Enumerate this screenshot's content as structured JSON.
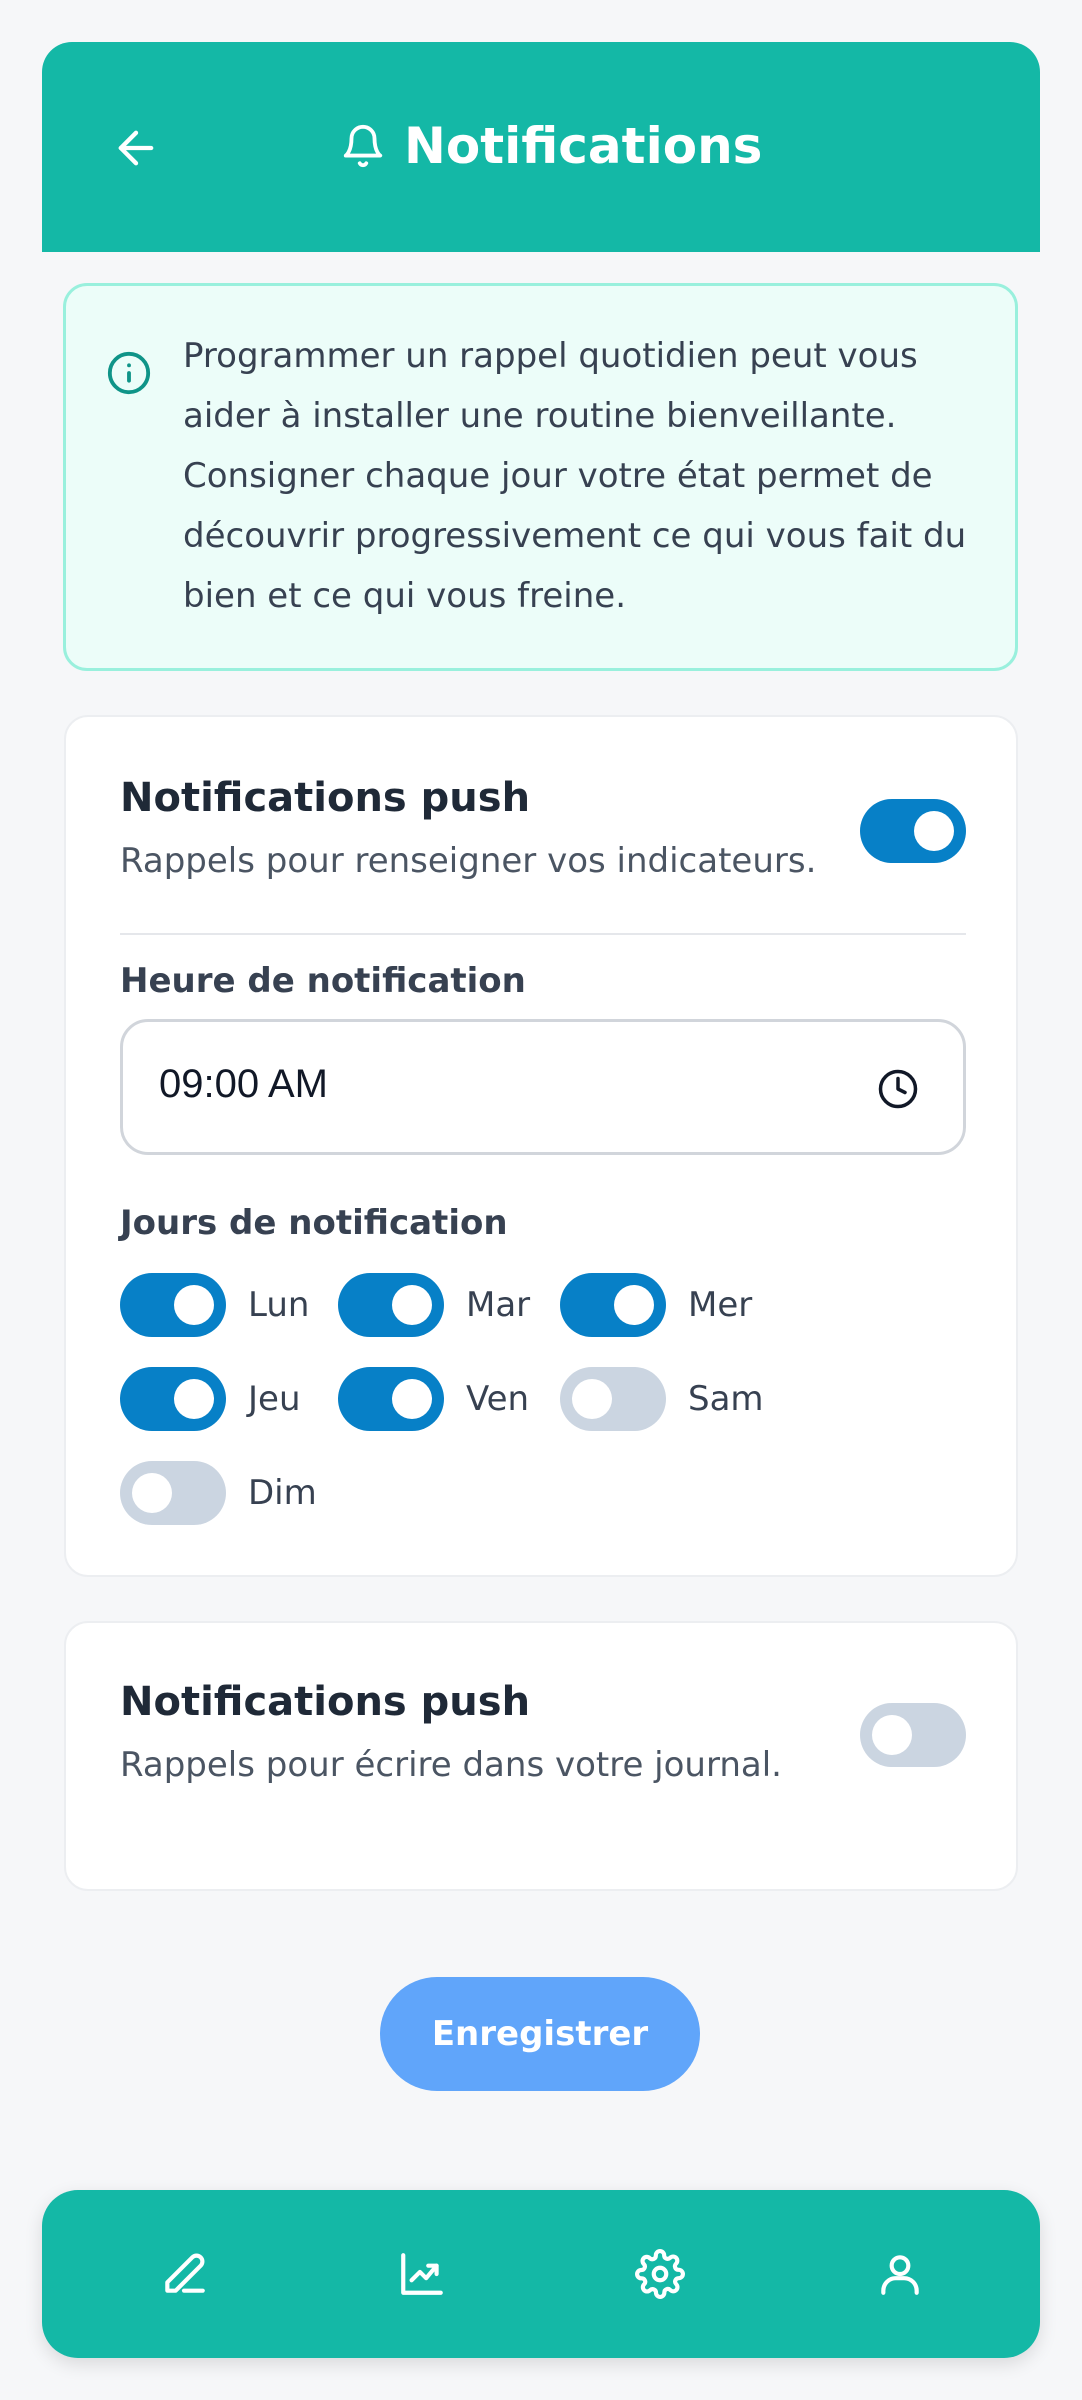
{
  "header": {
    "title": "Notifications",
    "back_icon": "arrow-left-icon",
    "title_icon": "bell-icon"
  },
  "info": {
    "icon": "info-icon",
    "text": "Programmer un rappel quotidien peut vous aider à installer une routine bienveillante. Consigner chaque jour votre état permet de découvrir progressivement ce qui vous fait du bien et ce qui vous freine."
  },
  "indicators_card": {
    "title": "Notifications push",
    "subtitle": "Rappels pour renseigner vos indicateurs.",
    "enabled": true,
    "time_label": "Heure de notification",
    "time_value": "09:00 AM",
    "days_label": "Jours de notification",
    "days": [
      {
        "label": "Lun",
        "on": true
      },
      {
        "label": "Mar",
        "on": true
      },
      {
        "label": "Mer",
        "on": true
      },
      {
        "label": "Jeu",
        "on": true
      },
      {
        "label": "Ven",
        "on": true
      },
      {
        "label": "Sam",
        "on": false
      },
      {
        "label": "Dim",
        "on": false
      }
    ]
  },
  "journal_card": {
    "title": "Notifications push",
    "subtitle": "Rappels pour écrire dans votre journal.",
    "enabled": false
  },
  "save_button": "Enregistrer",
  "bottom_nav": [
    "edit-icon",
    "chart-icon",
    "gear-icon",
    "user-icon"
  ],
  "colors": {
    "brand": "#14b8a6",
    "toggle_on": "#0780c7",
    "toggle_off": "#cbd5e1",
    "save_button": "#60a5fa",
    "info_bg": "#ecfdf9"
  }
}
